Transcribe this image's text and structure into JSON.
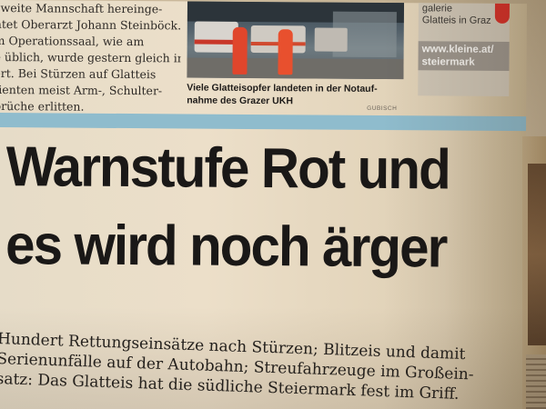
{
  "article_text": {
    "lines": [
      "zweite Mannschaft hereinge-",
      "htet Oberarzt Johann Steinböck.",
      "m Operationssaal, wie am",
      "e üblich, wurde gestern gleich in",
      "ert. Bei Stürzen auf Glatteis",
      "tienten meist Arm-, Schulter-",
      "brüche erlitten."
    ]
  },
  "photo": {
    "caption_lines": [
      "Viele Glatteisopfer landeten in der Notauf-",
      "nahme des Grazer UKH"
    ],
    "credit": "GUBISCH"
  },
  "sidebar": {
    "lines": [
      "galerie",
      "Glatteis in Graz"
    ],
    "link_lines": [
      "www.kleine.at/",
      "steiermark"
    ]
  },
  "headline": {
    "line1": "Warnstufe Rot und",
    "line2": "es wird noch ärger"
  },
  "subheadline": {
    "lines": [
      "Hundert Rettungseinsätze nach Stürzen; Blitzeis und damit",
      "Serienunfälle auf der Autobahn; Streufahrzeuge im Großein-",
      "satz: Das Glatteis hat die südliche Steiermark fest im Griff."
    ]
  },
  "colors": {
    "divider": "#8fbccd",
    "paper": "#e6dcc8",
    "accent_red": "#d5322a",
    "ink": "#1a1817"
  }
}
